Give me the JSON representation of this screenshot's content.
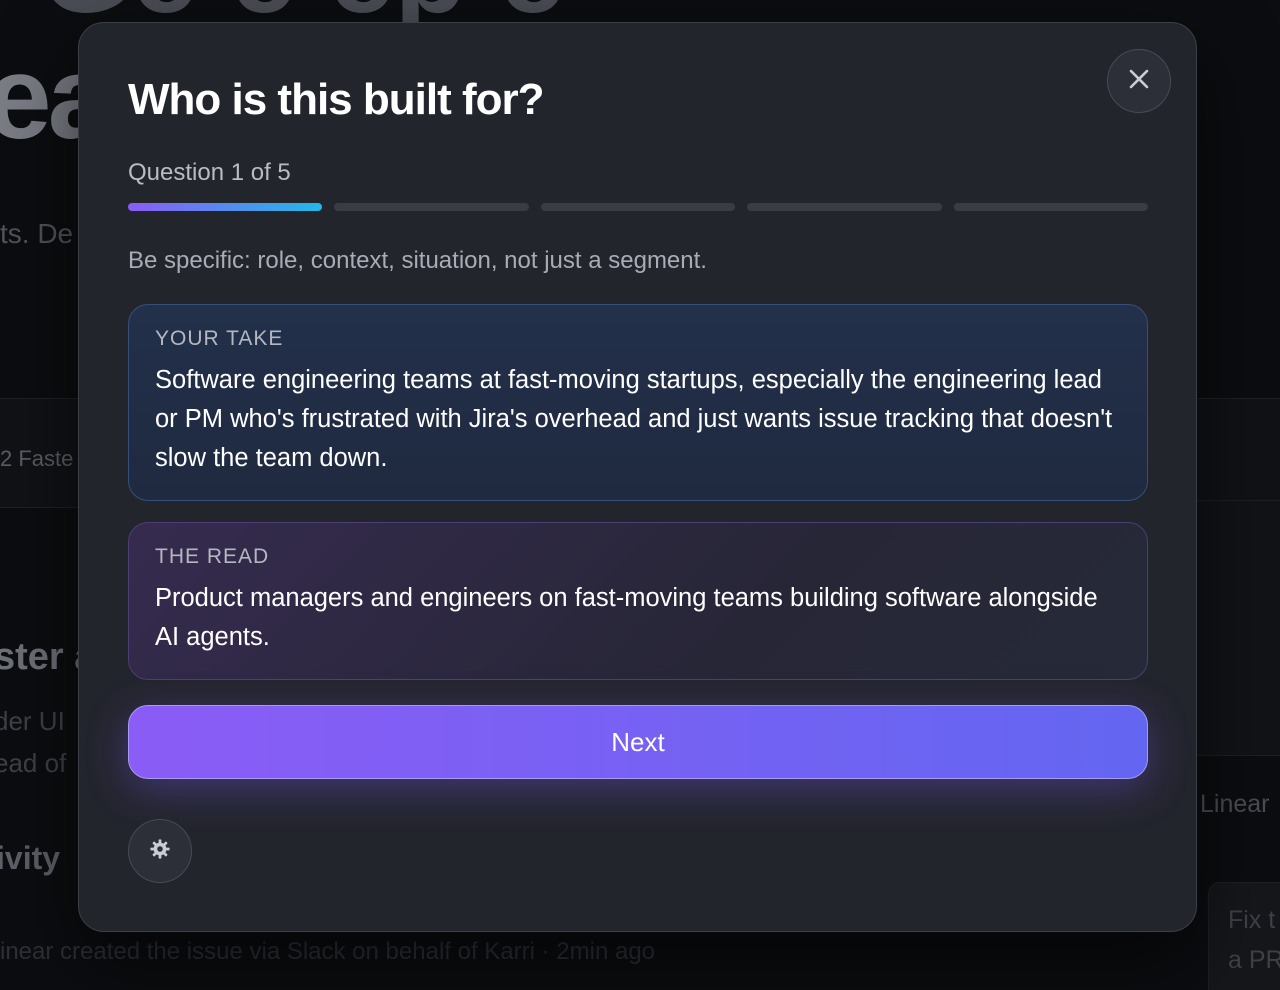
{
  "background": {
    "hero_top": "Ge  e  ep  e",
    "hero": "ea",
    "subtitle": "ts. De",
    "tab": "2  Faste",
    "heading": "ster a",
    "para_1": "der UI",
    "para_2": "ead of",
    "activity_heading": "ivity",
    "footer_activity": "inear created the issue via Slack on behalf of Karri  ·  2min ago",
    "right_linear": "Linear",
    "right_fix_1": "Fix t",
    "right_fix_2": "a PR"
  },
  "modal": {
    "title": "Who is this built for?",
    "close_icon": "close-icon",
    "progress": {
      "label": "Question 1 of 5",
      "current": 1,
      "total": 5
    },
    "hint": "Be specific: role, context, situation, not just a segment.",
    "your_take": {
      "label": "YOUR TAKE",
      "text": "Software engineering teams at fast-moving startups, especially the engineering lead or PM who's frustrated with Jira's overhead and just wants issue tracking that doesn't slow the team down."
    },
    "the_read": {
      "label": "THE READ",
      "text": "Product managers and engineers on fast-moving teams building software alongside AI agents."
    },
    "next_label": "Next",
    "settings_icon": "gear-icon"
  },
  "colors": {
    "accent_start": "#8b5cf6",
    "accent_end": "#6366f1",
    "progress_end": "#22b8e8",
    "modal_bg": "#23252d"
  }
}
